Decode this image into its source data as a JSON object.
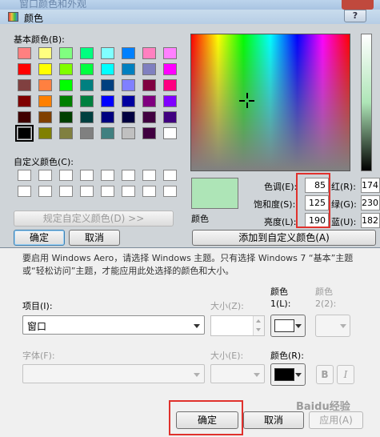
{
  "background_window": {
    "title": "窗口颜色和外观",
    "notice": "要启用 Windows Aero，请选择 Windows 主题。只有选择 Windows 7 “基本”主题或“轻松访问”主题，才能应用此处选择的颜色和大小。",
    "item_label": "项目(I):",
    "item_value": "窗口",
    "size_label_1": "大小(Z):",
    "color1_label_line1": "颜色",
    "color1_label_line2": "1(L):",
    "color2_label_line1": "颜色",
    "color2_label_line2": "2(2):",
    "font_label": "字体(F):",
    "size_label_2": "大小(E):",
    "font_color_label": "颜色(R):",
    "bold_label": "B",
    "italic_label": "I",
    "ok_label": "确定",
    "cancel_label": "取消",
    "apply_label": "应用(A)",
    "color1_swatch": "#ffffff",
    "font_color_swatch": "#000000"
  },
  "color_dialog": {
    "title": "颜色",
    "help_label": "?",
    "basic_colors_label": "基本颜色(B):",
    "custom_colors_label": "自定义颜色(C):",
    "define_custom_label": "规定自定义颜色(D) >>",
    "ok_label": "确定",
    "cancel_label": "取消",
    "color_solid_label": "颜色",
    "add_custom_label": "添加到自定义颜色(A)",
    "hue_label": "色调(E):",
    "hue_value": "85",
    "sat_label": "饱和度(S):",
    "sat_value": "125",
    "lum_label": "亮度(L):",
    "lum_value": "190",
    "red_label": "红(R):",
    "red_value": "174",
    "green_label": "绿(G):",
    "green_value": "230",
    "blue_label": "蓝(U):",
    "blue_value": "182",
    "preview_color": "#aee5b7",
    "basic_colors": [
      "#ff8080",
      "#ffff80",
      "#80ff80",
      "#00ff80",
      "#80ffff",
      "#0080ff",
      "#ff80c0",
      "#ff80ff",
      "#ff0000",
      "#ffff00",
      "#80ff00",
      "#00ff40",
      "#00ffff",
      "#0080c0",
      "#8080c0",
      "#ff00ff",
      "#804040",
      "#ff8040",
      "#00ff00",
      "#008080",
      "#004080",
      "#8080ff",
      "#800040",
      "#ff0080",
      "#800000",
      "#ff8000",
      "#008000",
      "#008040",
      "#0000ff",
      "#0000a0",
      "#800080",
      "#8000ff",
      "#400000",
      "#804000",
      "#004000",
      "#004040",
      "#000080",
      "#000040",
      "#400040",
      "#400080",
      "#000000",
      "#808000",
      "#808040",
      "#808080",
      "#408080",
      "#c0c0c0",
      "#400040",
      "#ffffff"
    ],
    "selected_basic_index": 40
  },
  "watermark": "Baidu经验"
}
